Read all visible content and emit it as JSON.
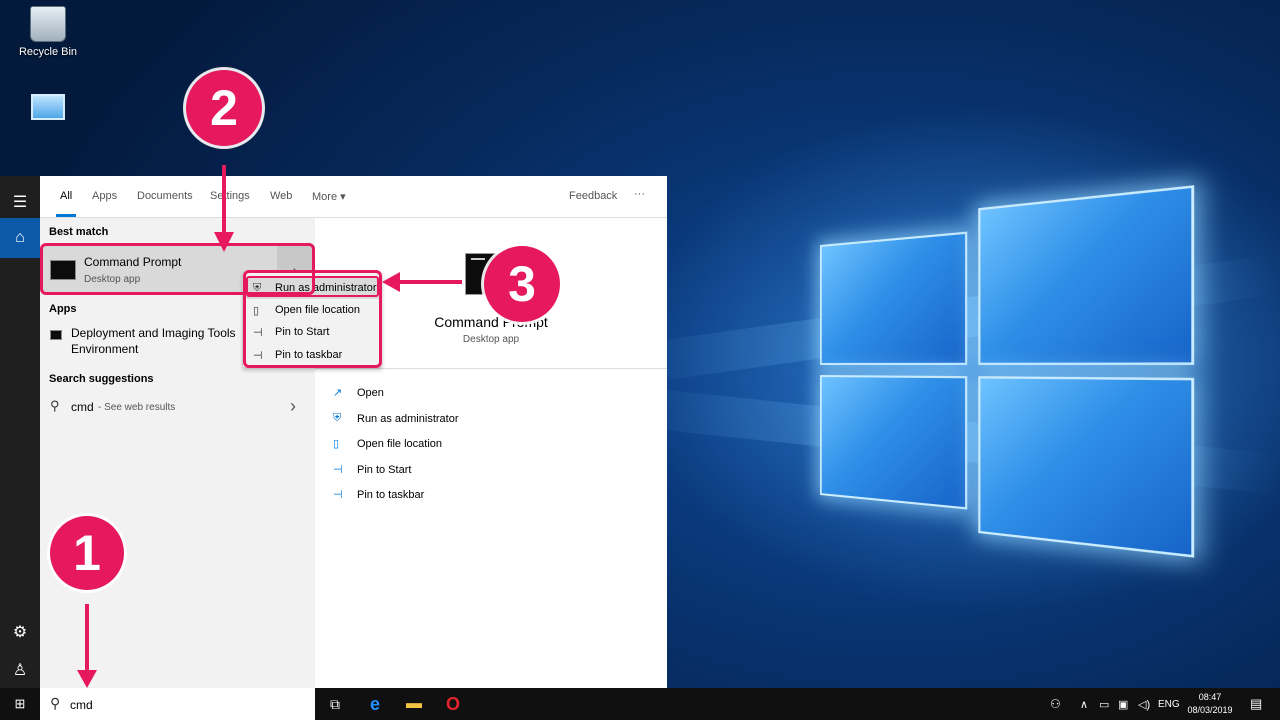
{
  "desktop": {
    "icons": [
      {
        "label": "Recycle Bin",
        "icon": "recycle-bin-icon"
      },
      {
        "label": "",
        "icon": "control-panel-icon"
      }
    ]
  },
  "search_panel": {
    "tabs": [
      "All",
      "Apps",
      "Documents",
      "Settings",
      "Web",
      "More ▾"
    ],
    "feedback": "Feedback",
    "more_dots": "···",
    "best_match_heading": "Best match",
    "best_match": {
      "title": "Command Prompt",
      "subtitle": "Desktop app"
    },
    "apps_heading": "Apps",
    "apps": [
      {
        "title_line1": "Deployment and Imaging Tools",
        "title_line2": "Environment"
      }
    ],
    "suggestions_heading": "Search suggestions",
    "suggestion": {
      "query": "cmd",
      "hint": " - See web results"
    },
    "detail": {
      "title": "Command Prompt",
      "subtitle": "Desktop app",
      "actions": [
        "Open",
        "Run as administrator",
        "Open file location",
        "Pin to Start",
        "Pin to taskbar"
      ]
    }
  },
  "context_menu": {
    "items": [
      "Run as administrator",
      "Open file location",
      "Pin to Start",
      "Pin to taskbar"
    ]
  },
  "annotations": {
    "step1": "1",
    "step2": "2",
    "step3": "3",
    "color": "#e6195f"
  },
  "taskbar": {
    "search_value": "cmd",
    "language": "ENG",
    "time": "08:47",
    "date": "08/03/2019"
  }
}
